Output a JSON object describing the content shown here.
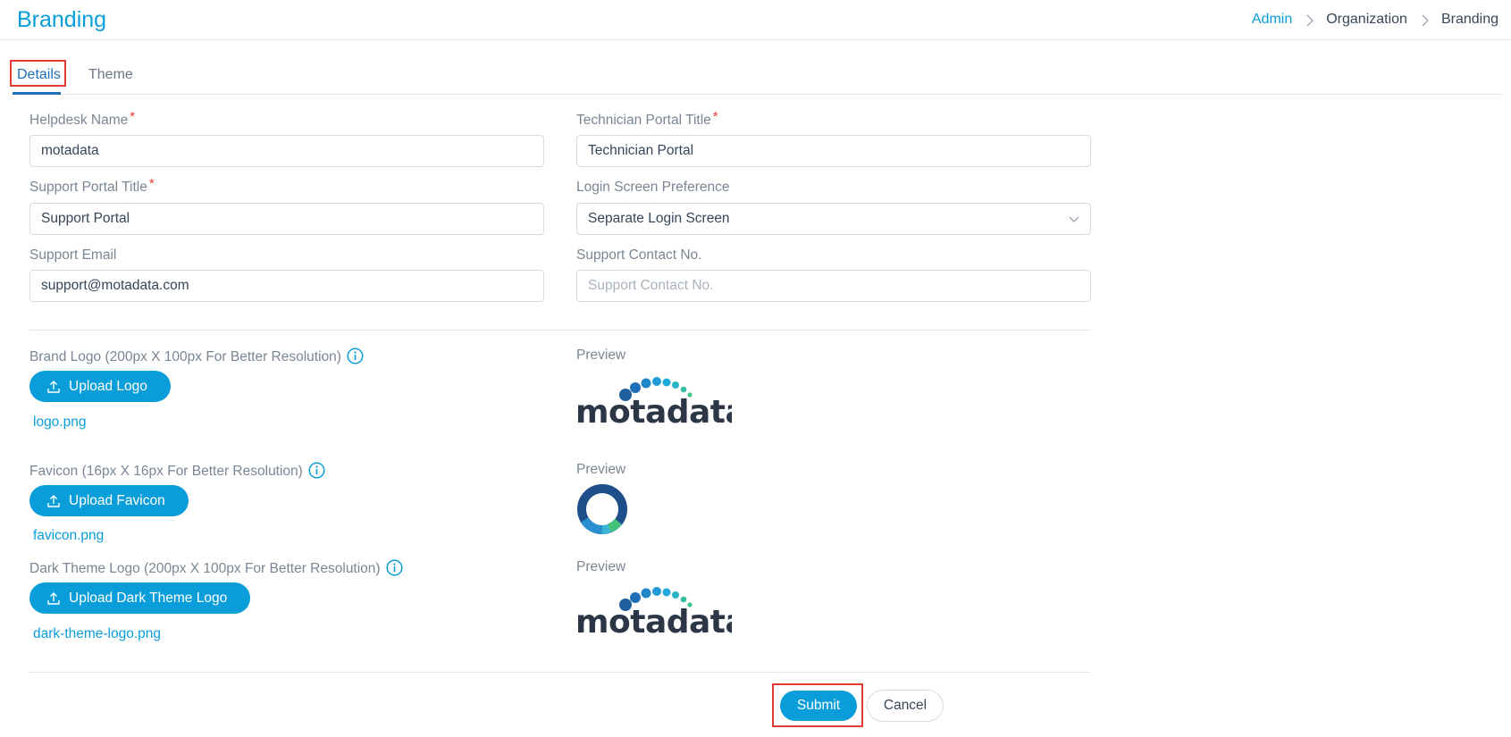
{
  "header": {
    "title": "Branding",
    "breadcrumb": [
      "Admin",
      "Organization",
      "Branding"
    ]
  },
  "tabs": [
    {
      "label": "Details",
      "active": true
    },
    {
      "label": "Theme",
      "active": false
    }
  ],
  "form": {
    "helpdesk_name": {
      "label": "Helpdesk Name",
      "required": "*",
      "value": "motadata"
    },
    "technician_portal_title": {
      "label": "Technician Portal Title",
      "required": "*",
      "value": "Technician Portal"
    },
    "support_portal_title": {
      "label": "Support Portal Title",
      "required": "*",
      "value": "Support Portal"
    },
    "login_screen_preference": {
      "label": "Login Screen Preference",
      "value": "Separate Login Screen"
    },
    "support_email": {
      "label": "Support Email",
      "value": "support@motadata.com"
    },
    "support_contact_no": {
      "label": "Support Contact No.",
      "value": "",
      "placeholder": "Support Contact No."
    }
  },
  "uploads": {
    "brand_logo": {
      "label": "Brand Logo (200px X 100px For Better Resolution)",
      "button": "Upload Logo",
      "file": "logo.png",
      "preview_label": "Preview"
    },
    "favicon": {
      "label": "Favicon (16px X 16px For Better Resolution)",
      "button": "Upload Favicon",
      "file": "favicon.png",
      "preview_label": "Preview"
    },
    "dark_theme_logo": {
      "label": "Dark Theme Logo (200px X 100px For Better Resolution)",
      "button": "Upload Dark Theme Logo",
      "file": "dark-theme-logo.png",
      "preview_label": "Preview"
    }
  },
  "logo_text": "motadata",
  "actions": {
    "submit": "Submit",
    "cancel": "Cancel"
  },
  "colors": {
    "accent": "#099dd9",
    "highlight": "#e53935",
    "logo_dark": "#2b3646",
    "logo_blue": "#1f6fb6"
  }
}
